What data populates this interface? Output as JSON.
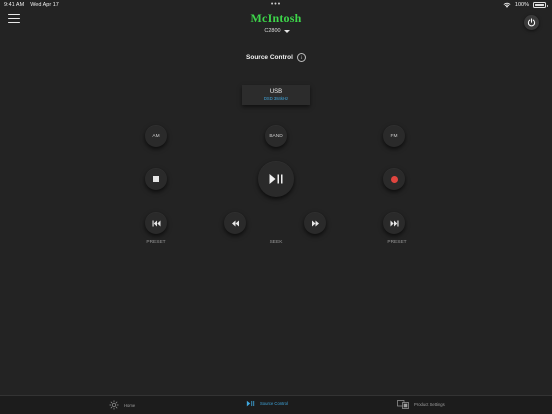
{
  "status_bar": {
    "time": "9:41 AM",
    "date": "Wed Apr 17",
    "dots": "•••",
    "battery_percent": "100%"
  },
  "header": {
    "brand": "McIntosh",
    "model": "C2800",
    "icons": {
      "menu": "hamburger-menu-icon",
      "power": "power-icon",
      "model_dropdown": "chevron-down-icon"
    }
  },
  "source_control": {
    "title": "Source Control",
    "info_icon": "i",
    "source": {
      "name": "USB",
      "detail": "DSD 384kHz"
    }
  },
  "controls": {
    "am_label": "AM",
    "band_label": "BAND",
    "fm_label": "FM",
    "preset_label": "PRESET",
    "seek_label": "SEEK"
  },
  "colors": {
    "accent": "#3fa8e0",
    "brand": "#3dd64a",
    "record": "#e0453f",
    "background": "#232323"
  },
  "tabbar": {
    "tabs": [
      {
        "label": "Home",
        "icon": "sun-icon",
        "active": false
      },
      {
        "label": "Source Control",
        "icon": "play-pause-icon",
        "active": true
      },
      {
        "label": "Product Settings",
        "icon": "devices-icon",
        "active": false
      }
    ]
  }
}
